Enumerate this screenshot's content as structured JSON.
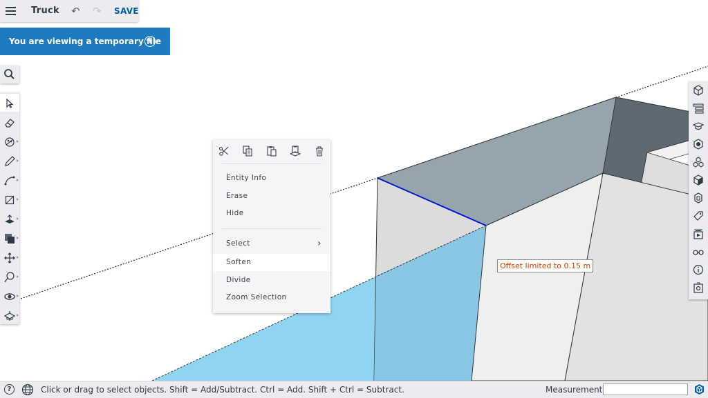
{
  "header": {
    "document_title": "Truck",
    "undo_icon": "undo-icon",
    "redo_icon": "redo-icon",
    "save_label": "SAVE"
  },
  "banner": {
    "text": "You are viewing a temporary file",
    "icon": "info-icon",
    "color": "#1e7bbf"
  },
  "search": {
    "icon": "search-icon"
  },
  "left_toolbar": {
    "tools": [
      {
        "name": "select-tool",
        "icon": "arrow-cursor-icon",
        "active": true,
        "has_submenu": false
      },
      {
        "name": "eraser-tool",
        "icon": "eraser-icon",
        "active": false,
        "has_submenu": false
      },
      {
        "name": "paint-tool",
        "icon": "paint-bucket-icon",
        "active": false,
        "has_submenu": true
      },
      {
        "name": "line-tool",
        "icon": "pencil-icon",
        "active": false,
        "has_submenu": true
      },
      {
        "name": "arc-tool",
        "icon": "arc-icon",
        "active": false,
        "has_submenu": true
      },
      {
        "name": "rectangle-tool",
        "icon": "rectangle-icon",
        "active": false,
        "has_submenu": true
      },
      {
        "name": "push-pull-tool",
        "icon": "push-pull-icon",
        "active": false,
        "has_submenu": true
      },
      {
        "name": "offset-tool",
        "icon": "offset-icon",
        "active": false,
        "has_submenu": true
      },
      {
        "name": "move-tool",
        "icon": "move-icon",
        "active": false,
        "has_submenu": true
      },
      {
        "name": "tape-measure-tool",
        "icon": "tape-measure-icon",
        "active": false,
        "has_submenu": true
      },
      {
        "name": "orbit-tool",
        "icon": "orbit-icon",
        "active": false,
        "has_submenu": true
      },
      {
        "name": "section-plane-tool",
        "icon": "section-plane-icon",
        "active": false,
        "has_submenu": true
      }
    ]
  },
  "right_panel": {
    "tools": [
      {
        "name": "entity-info-panel",
        "icon": "cube-info-icon"
      },
      {
        "name": "outliner-panel",
        "icon": "outliner-icon"
      },
      {
        "name": "instructor-panel",
        "icon": "graduation-cap-icon"
      },
      {
        "name": "materials-panel",
        "icon": "materials-icon"
      },
      {
        "name": "components-panel",
        "icon": "components-icon"
      },
      {
        "name": "styles-panel",
        "icon": "styles-cube-icon"
      },
      {
        "name": "solid-inspector-panel",
        "icon": "solid-icon"
      },
      {
        "name": "tags-panel",
        "icon": "tag-icon"
      },
      {
        "name": "scenes-panel",
        "icon": "scenes-icon"
      },
      {
        "name": "display-panel",
        "icon": "glasses-icon"
      },
      {
        "name": "model-info-panel",
        "icon": "info-icon"
      },
      {
        "name": "extensions-panel",
        "icon": "extension-icon"
      }
    ]
  },
  "context_menu": {
    "toolbar_icons": [
      "scissors-icon",
      "copy-icon",
      "paste-icon",
      "paste-in-place-icon",
      "trash-icon"
    ],
    "items": [
      {
        "label": "Entity Info"
      },
      {
        "label": "Erase"
      },
      {
        "label": "Hide"
      },
      {
        "label": "Select",
        "submenu": true
      },
      {
        "label": "Soften",
        "highlighted": true
      },
      {
        "label": "Divide"
      },
      {
        "label": "Zoom Selection"
      }
    ]
  },
  "canvas": {
    "tooltip": "Offset limited to 0.15 m",
    "colors": {
      "top_face": "#96a4ad",
      "side_face": "#dcdcdc",
      "front_face": "#efefef",
      "selected_face": "#8fd4f0",
      "selected_edge": "#0018d0",
      "inner_top": "#5d6a73"
    }
  },
  "status_bar": {
    "help_icon": "help-icon",
    "globe_icon": "globe-icon",
    "message": "Click or drag to select objects. Shift = Add/Subtract. Ctrl = Add. Shift + Ctrl = Subtract.",
    "measurements_label": "Measurements",
    "measurements_value": "",
    "logo_icon": "sketchup-logo-icon"
  }
}
